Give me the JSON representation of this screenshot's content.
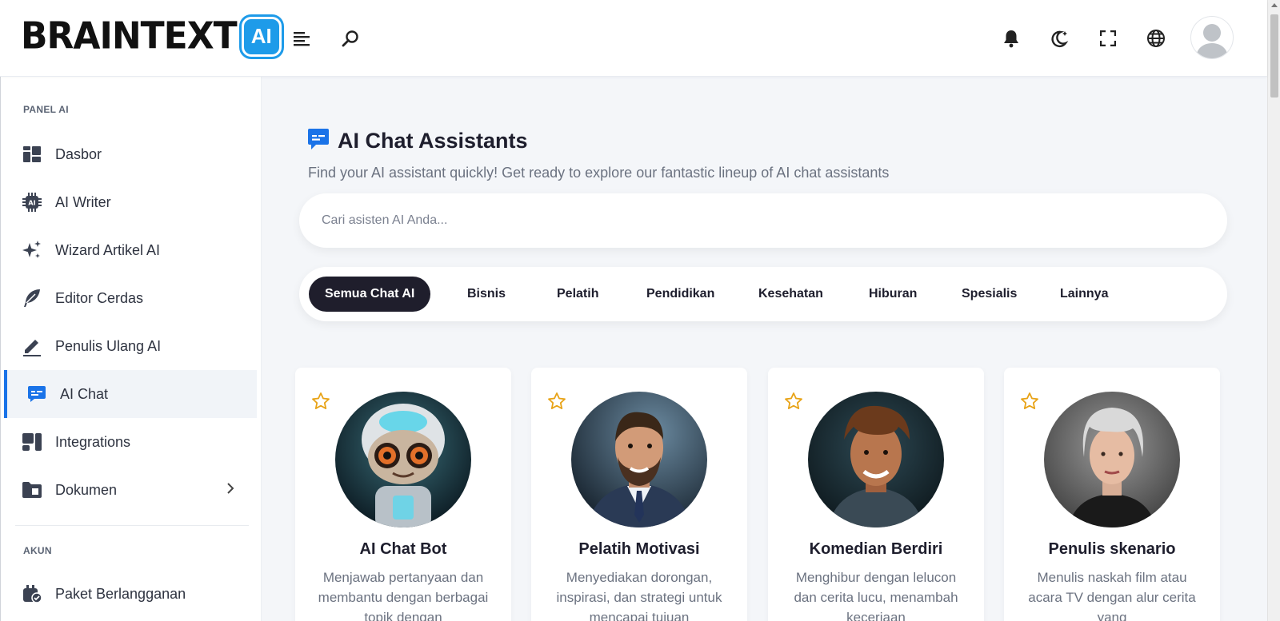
{
  "brand": {
    "text": "BRAINTEXT",
    "chip": "AI"
  },
  "sidebar": {
    "sections": [
      {
        "label": "PANEL AI"
      },
      {
        "label": "AKUN"
      }
    ],
    "items": [
      {
        "label": "Dasbor",
        "icon": "dashboard-icon"
      },
      {
        "label": "AI Writer",
        "icon": "ai-chip-icon"
      },
      {
        "label": "Wizard Artikel AI",
        "icon": "sparkles-icon"
      },
      {
        "label": "Editor Cerdas",
        "icon": "feather-icon"
      },
      {
        "label": "Penulis Ulang AI",
        "icon": "pen-icon"
      },
      {
        "label": "AI Chat",
        "icon": "chat-icon",
        "active": true
      },
      {
        "label": "Integrations",
        "icon": "integrations-icon"
      },
      {
        "label": "Dokumen",
        "icon": "folder-icon"
      },
      {
        "label": "Paket Berlangganan",
        "icon": "subscription-icon"
      }
    ]
  },
  "main": {
    "title": "AI Chat Assistants",
    "subtitle": "Find your AI assistant quickly! Get ready to explore our fantastic lineup of AI chat assistants",
    "search_placeholder": "Cari asisten AI Anda...",
    "filters": [
      "Semua Chat AI",
      "Bisnis",
      "Pelatih",
      "Pendidikan",
      "Kesehatan",
      "Hiburan",
      "Spesialis",
      "Lainnya"
    ],
    "active_filter": "Semua Chat AI",
    "cards": [
      {
        "name": "AI Chat Bot",
        "desc": "Menjawab pertanyaan dan membantu dengan berbagai topik dengan"
      },
      {
        "name": "Pelatih Motivasi",
        "desc": "Menyediakan dorongan, inspirasi, dan strategi untuk mencapai tujuan"
      },
      {
        "name": "Komedian Berdiri",
        "desc": "Menghibur dengan lelucon dan cerita lucu, menambah keceriaan"
      },
      {
        "name": "Penulis skenario",
        "desc": "Menulis naskah film atau acara TV dengan alur cerita yang"
      }
    ]
  },
  "colors": {
    "accent": "#1a73e8",
    "dark_chip": "#1f1e2c",
    "star": "#e8a317",
    "brand_chip": "#1e9be9"
  }
}
